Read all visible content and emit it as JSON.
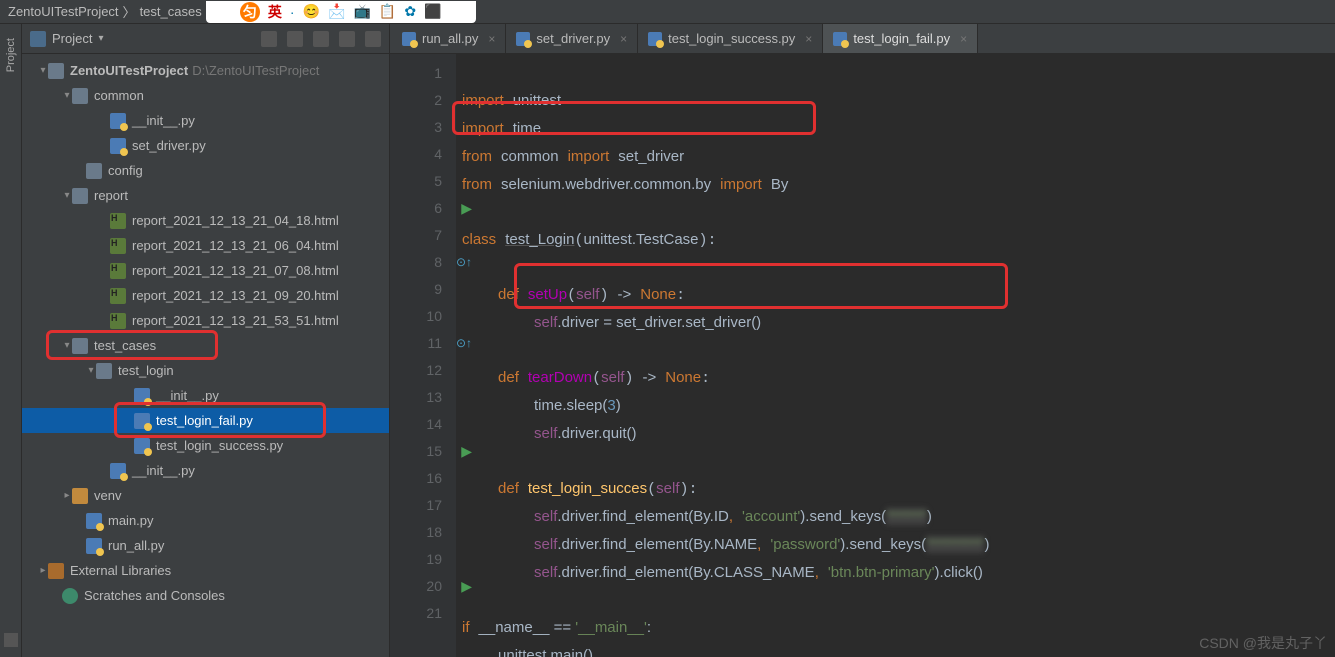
{
  "breadcrumb": {
    "project": "ZentoUITestProject",
    "file": "test_cases"
  },
  "project_panel": {
    "title": "Project"
  },
  "tree": {
    "root_name": "ZentoUITestProject",
    "root_path": "D:\\ZentoUITestProject",
    "common": {
      "label": "common",
      "init": "__init__.py",
      "set_driver": "set_driver.py"
    },
    "config": "config",
    "report": {
      "label": "report",
      "files": [
        "report_2021_12_13_21_04_18.html",
        "report_2021_12_13_21_06_04.html",
        "report_2021_12_13_21_07_08.html",
        "report_2021_12_13_21_09_20.html",
        "report_2021_12_13_21_53_51.html"
      ]
    },
    "test_cases": {
      "label": "test_cases",
      "test_login": {
        "label": "test_login",
        "init": "__init__.py",
        "fail": "test_login_fail.py",
        "success": "test_login_success.py"
      },
      "init": "__init__.py"
    },
    "venv": "venv",
    "main": "main.py",
    "run_all": "run_all.py",
    "ext_lib": "External Libraries",
    "scratch": "Scratches and Consoles"
  },
  "tabs": [
    {
      "label": "run_all.py",
      "active": false
    },
    {
      "label": "set_driver.py",
      "active": false
    },
    {
      "label": "test_login_success.py",
      "active": false
    },
    {
      "label": "test_login_fail.py",
      "active": true
    }
  ],
  "code": {
    "l1": {
      "k1": "import",
      "v1": "unittest"
    },
    "l2": {
      "k1": "import",
      "v1": "time"
    },
    "l3": {
      "k1": "from",
      "v1": "common",
      "k2": "import",
      "v2": "set_driver"
    },
    "l4": {
      "k1": "from",
      "v1": "selenium.webdriver.common.by",
      "k2": "import",
      "v2": "By"
    },
    "l6": {
      "k1": "class",
      "cls": "test_Login",
      "base": "unittest.TestCase"
    },
    "l8": {
      "k1": "def",
      "fn": "setUp",
      "p": "self",
      "arrow": "->",
      "none": "None"
    },
    "l9": {
      "self": "self",
      "rest": ".driver = set_driver.set_driver()"
    },
    "l11": {
      "k1": "def",
      "fn": "tearDown",
      "p": "self",
      "arrow": "->",
      "none": "None"
    },
    "l12": {
      "txt": "time.sleep(",
      "num": "3",
      "end": ")"
    },
    "l13": {
      "self": "self",
      "rest": ".driver.quit()"
    },
    "l15": {
      "k1": "def",
      "fn": "test_login_succes",
      "p": "self"
    },
    "l16": {
      "self": "self",
      "a": ".driver.find_element(By.ID",
      "c": ",",
      "s1": "'account'",
      "b": ").send_keys(",
      "s2": "'******'",
      "e": ")"
    },
    "l17": {
      "self": "self",
      "a": ".driver.find_element(By.NAME",
      "c": ",",
      "s1": "'password'",
      "b": ").send_keys(",
      "s2": "'*********'",
      "e": ")"
    },
    "l18": {
      "self": "self",
      "a": ".driver.find_element(By.CLASS_NAME",
      "c": ",",
      "s1": "'btn.btn-primary'",
      "b": ").click()"
    },
    "l20": {
      "k1": "if",
      "a": "__name__ == ",
      "s": "'__main__'",
      "e": ":"
    },
    "l21": {
      "txt": "unittest.main()"
    }
  },
  "line_numbers": [
    "1",
    "2",
    "3",
    "4",
    "5",
    "6",
    "7",
    "8",
    "9",
    "10",
    "11",
    "12",
    "13",
    "14",
    "15",
    "16",
    "17",
    "18",
    "19",
    "20",
    "21"
  ],
  "watermark": "CSDN @我是丸子丫"
}
